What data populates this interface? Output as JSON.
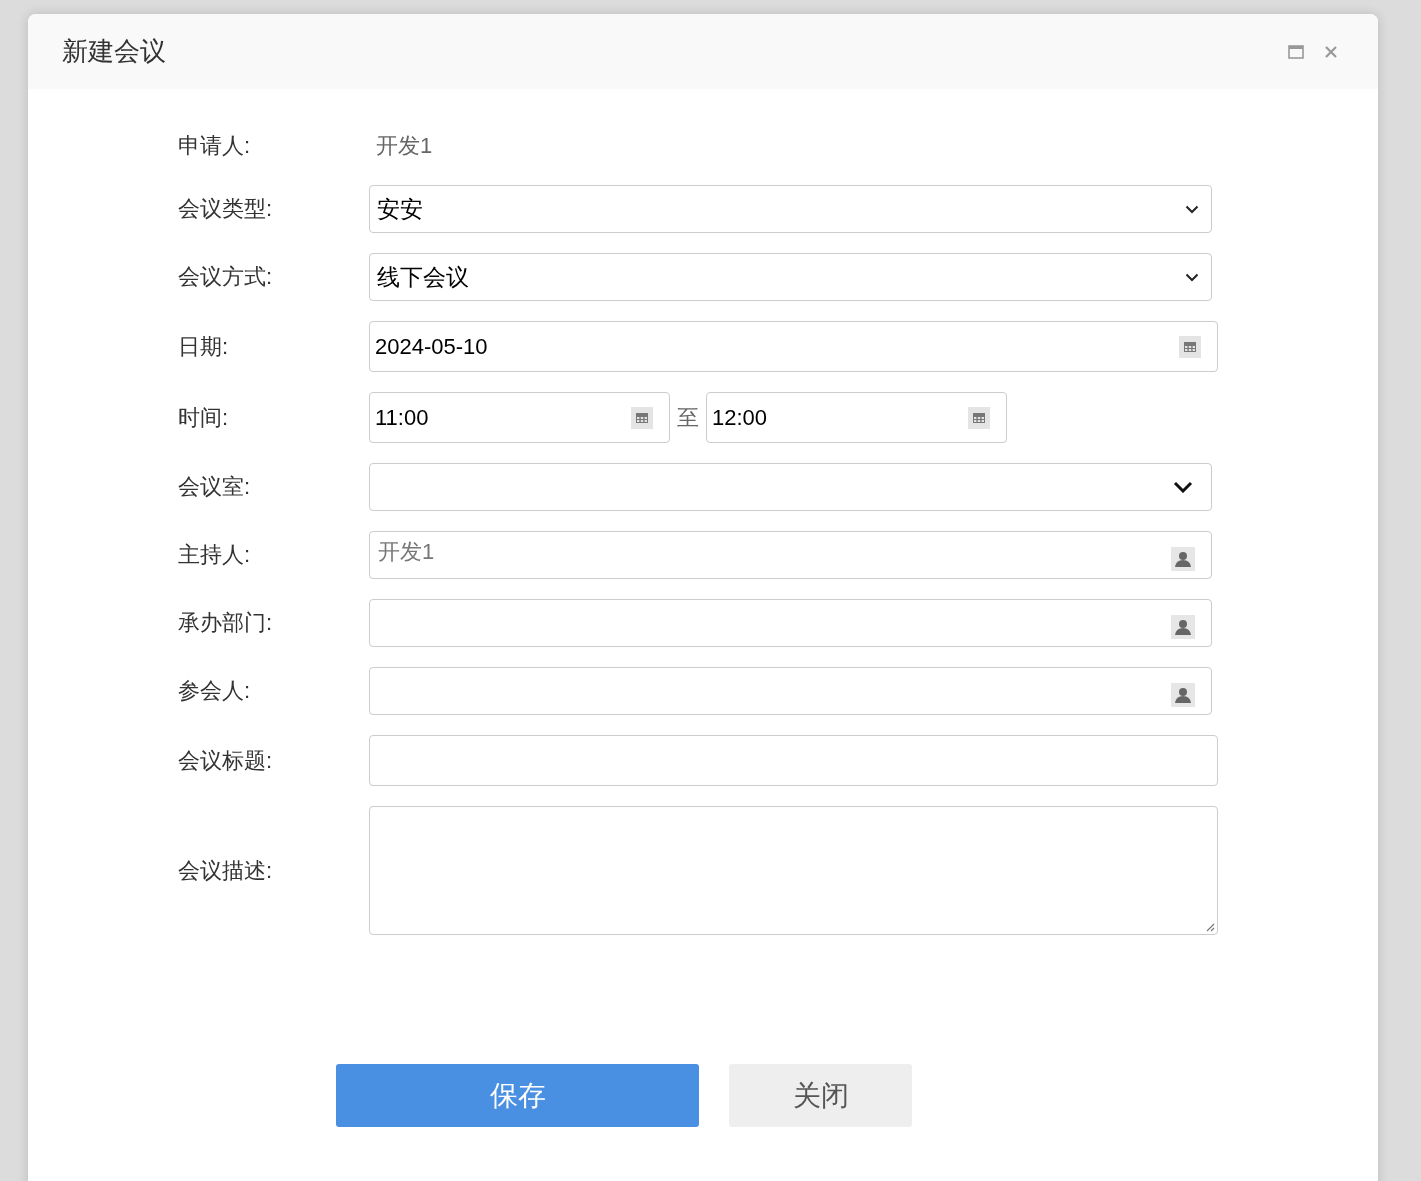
{
  "dialog": {
    "title": "新建会议"
  },
  "fields": [
    {
      "kind": "static",
      "label": "申请人:",
      "value": "开发1"
    },
    {
      "kind": "select",
      "label": "会议类型:",
      "value": "安安"
    },
    {
      "kind": "select",
      "label": "会议方式:",
      "value": "线下会议"
    },
    {
      "kind": "date",
      "label": "日期:",
      "value": "2024-05-10"
    },
    {
      "kind": "timerange",
      "label": "时间:",
      "start": "11:00",
      "separator": "至",
      "end": "12:00"
    },
    {
      "kind": "combo",
      "label": "会议室:"
    },
    {
      "kind": "picker",
      "label": "主持人:",
      "value": "开发1"
    },
    {
      "kind": "picker",
      "label": "承办部门:"
    },
    {
      "kind": "picker",
      "label": "参会人:"
    },
    {
      "kind": "text",
      "label": "会议标题:"
    },
    {
      "kind": "textarea",
      "label": "会议描述:"
    }
  ],
  "buttons": [
    {
      "kind": "primary",
      "label": "保存"
    },
    {
      "kind": "secondary",
      "label": "关闭"
    }
  ]
}
